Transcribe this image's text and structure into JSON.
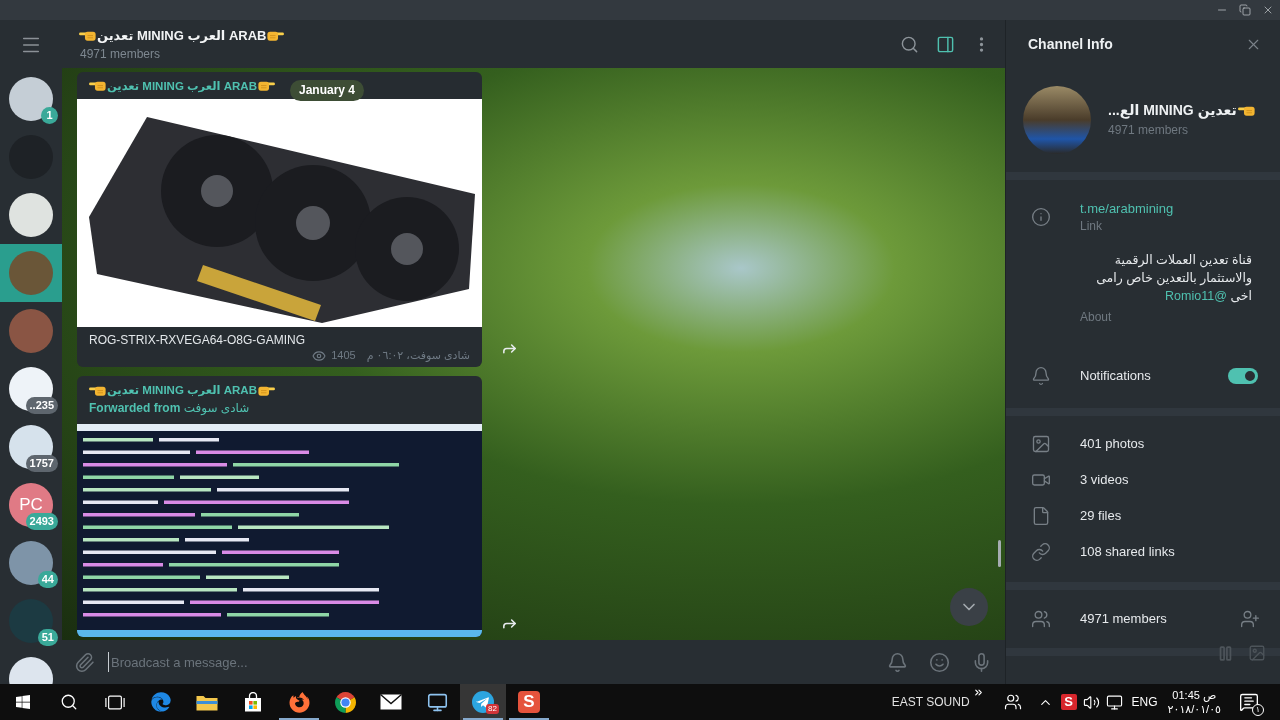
{
  "sidebar": {
    "chats": [
      {
        "color": "#c5ced6",
        "badge": "1",
        "muted": false,
        "selected": false
      },
      {
        "color": "#1e2226",
        "selected": false
      },
      {
        "color": "#dfe3e0",
        "selected": false
      },
      {
        "color": "#6a5638",
        "selected": true
      },
      {
        "color": "#8a5544",
        "selected": false
      },
      {
        "color": "#eef3f8",
        "badge": "..235",
        "muted": true,
        "selected": false
      },
      {
        "color": "#d6e2ec",
        "badge": "1757",
        "muted": true,
        "selected": false
      },
      {
        "color": "#e07a85",
        "initials": "PC",
        "badge": "2493",
        "muted": false,
        "selected": false
      },
      {
        "color": "#7e94a8",
        "badge": "44",
        "muted": false,
        "selected": false
      },
      {
        "color": "#1c3a42",
        "badge": "51",
        "muted": false,
        "selected": false
      },
      {
        "color": "#dde5ee",
        "selected": false
      }
    ]
  },
  "header": {
    "title": "تعدين MINING العرب ARAB",
    "subtitle": "4971 members",
    "panel_toggle_on": true
  },
  "chat": {
    "date": "January 4",
    "messages": [
      {
        "kind": "photo",
        "sender": "تعدين MINING العرب ARAB",
        "caption": "ROG-STRIX-RXVEGA64-O8G-GAMING",
        "views": "1405",
        "signature": "شادی سوفت، ٠٦:٠٢ م"
      },
      {
        "kind": "forwarded",
        "sender": "تعدين MINING العرب ARAB",
        "forwarded": "**Forwarded from** شادى سوفت"
      }
    ]
  },
  "composer": {
    "placeholder": "Broadcast a message..."
  },
  "info_panel": {
    "title": "Channel Info",
    "channel_name": "تعدين MINING الع...",
    "members": "4971 members",
    "link": "t.me/arabmining",
    "link_label": "Link",
    "about_lines": [
      "قناة تعدين العملات الرقمية",
      "والاستثمار بالتعدين خاص رامى",
      "اخى"
    ],
    "about_mention": "@Romio11",
    "about_label": "About",
    "notifications": {
      "label": "Notifications",
      "on": true
    },
    "media": [
      {
        "kind": "photos",
        "label": "401 photos"
      },
      {
        "kind": "videos",
        "label": "3 videos"
      },
      {
        "kind": "files",
        "label": "29 files"
      },
      {
        "kind": "links",
        "label": "108 shared links"
      }
    ],
    "members_row": "4971 members"
  },
  "taskbar": {
    "items": [
      {
        "kind": "start",
        "running": false,
        "selected": false
      },
      {
        "kind": "search",
        "running": false,
        "selected": false
      },
      {
        "kind": "task_view",
        "running": false,
        "selected": false
      },
      {
        "kind": "edge",
        "running": false,
        "selected": false
      },
      {
        "kind": "explorer",
        "running": false,
        "selected": false
      },
      {
        "kind": "store",
        "running": false,
        "selected": false
      },
      {
        "kind": "firefox",
        "running": true,
        "selected": false
      },
      {
        "kind": "chrome",
        "running": false,
        "selected": false
      },
      {
        "kind": "mail",
        "running": false,
        "selected": false
      },
      {
        "kind": "remote",
        "running": false,
        "selected": false
      },
      {
        "kind": "telegram",
        "running": true,
        "selected": true,
        "badge": "82"
      },
      {
        "kind": "letter_app",
        "glyph": "S",
        "running": true,
        "selected": false
      }
    ],
    "tray": {
      "label": "EAST SOUND",
      "app_glyph": "S",
      "language": "ENG",
      "time": "01:45 ص",
      "date": "٢٠١٨/٠١/٠٥",
      "notification_count": "١"
    }
  }
}
